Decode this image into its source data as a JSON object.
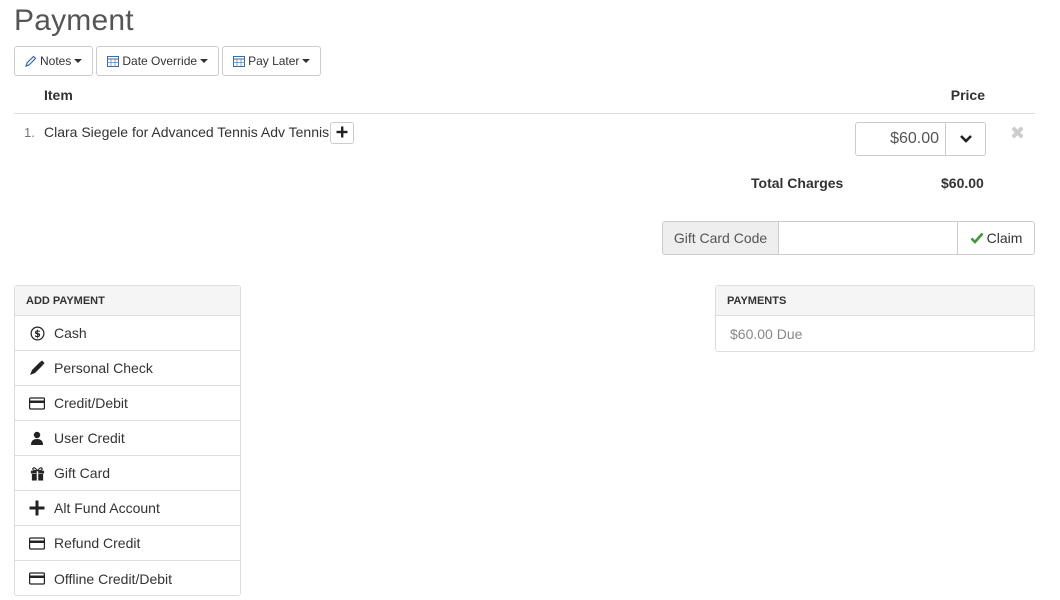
{
  "page": {
    "title": "Payment"
  },
  "toolbar": {
    "notes_label": "Notes",
    "date_override_label": "Date Override",
    "pay_later_label": "Pay Later"
  },
  "items_table": {
    "item_header": "Item",
    "price_header": "Price",
    "rows": [
      {
        "number": "1.",
        "description": "Clara Siegele for Advanced Tennis Adv Tennis1",
        "price": "$60.00"
      }
    ]
  },
  "totals": {
    "label": "Total Charges",
    "value": "$60.00"
  },
  "gift_card": {
    "label": "Gift Card Code",
    "value": "",
    "claim_label": "Claim"
  },
  "add_payment": {
    "title": "ADD PAYMENT",
    "methods": [
      {
        "label": "Cash",
        "icon": "dollar-circle-icon"
      },
      {
        "label": "Personal Check",
        "icon": "pen-icon"
      },
      {
        "label": "Credit/Debit",
        "icon": "credit-card-icon"
      },
      {
        "label": "User Credit",
        "icon": "user-icon"
      },
      {
        "label": "Gift Card",
        "icon": "gift-icon"
      },
      {
        "label": "Alt Fund Account",
        "icon": "plus-icon"
      },
      {
        "label": "Refund Credit",
        "icon": "credit-card-icon"
      },
      {
        "label": "Offline Credit/Debit",
        "icon": "credit-card-icon"
      }
    ]
  },
  "payments": {
    "title": "PAYMENTS",
    "due_text": "$60.00 Due"
  },
  "colors": {
    "check_green": "#3c9a3c",
    "remove_gray": "#cccccc",
    "panel_header_bg": "#f5f5f5"
  }
}
